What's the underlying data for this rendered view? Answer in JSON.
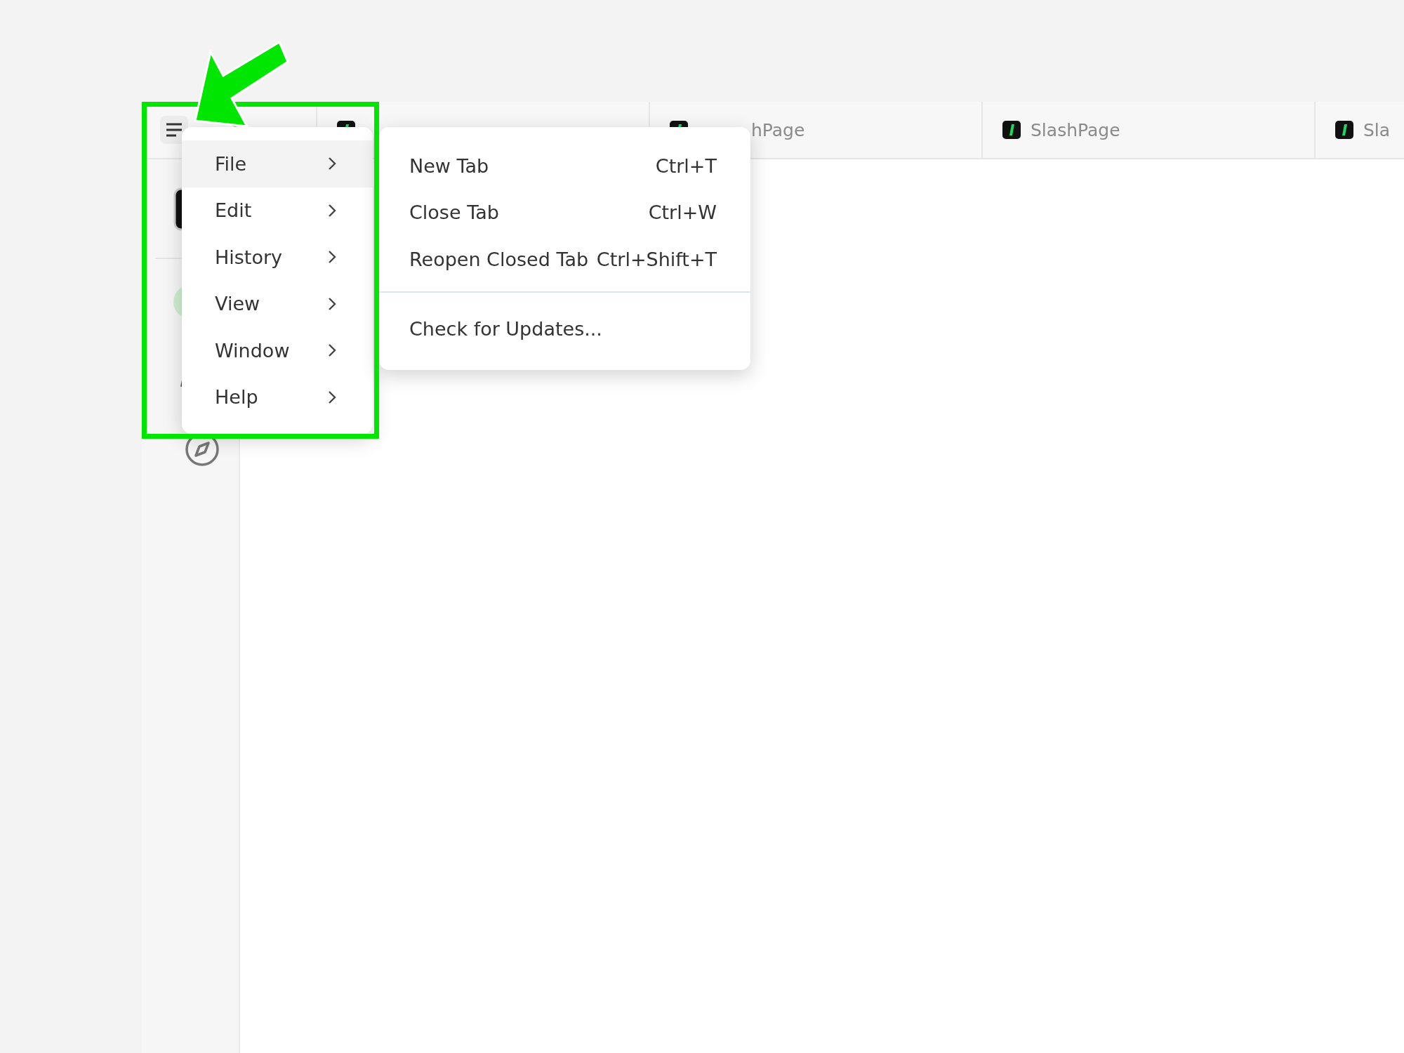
{
  "tabs": [
    {
      "kind": "covered"
    },
    {
      "kind": "partly-covered",
      "label": "hPage"
    },
    {
      "kind": "plain",
      "label": "SlashPage"
    },
    {
      "kind": "plain",
      "label": "Sla"
    }
  ],
  "menu": {
    "items": [
      {
        "label": "File",
        "selected": true
      },
      {
        "label": "Edit",
        "selected": false
      },
      {
        "label": "History",
        "selected": false
      },
      {
        "label": "View",
        "selected": false
      },
      {
        "label": "Window",
        "selected": false
      },
      {
        "label": "Help",
        "selected": false
      }
    ]
  },
  "submenu": {
    "groups": [
      [
        {
          "label": "New Tab",
          "shortcut": "Ctrl+T"
        },
        {
          "label": "Close Tab",
          "shortcut": "Ctrl+W"
        },
        {
          "label": "Reopen Closed Tab",
          "shortcut": "Ctrl+Shift+T"
        }
      ],
      [
        {
          "label": "Check for Updates..."
        }
      ]
    ]
  },
  "annotation": {
    "color": "#00e600"
  }
}
